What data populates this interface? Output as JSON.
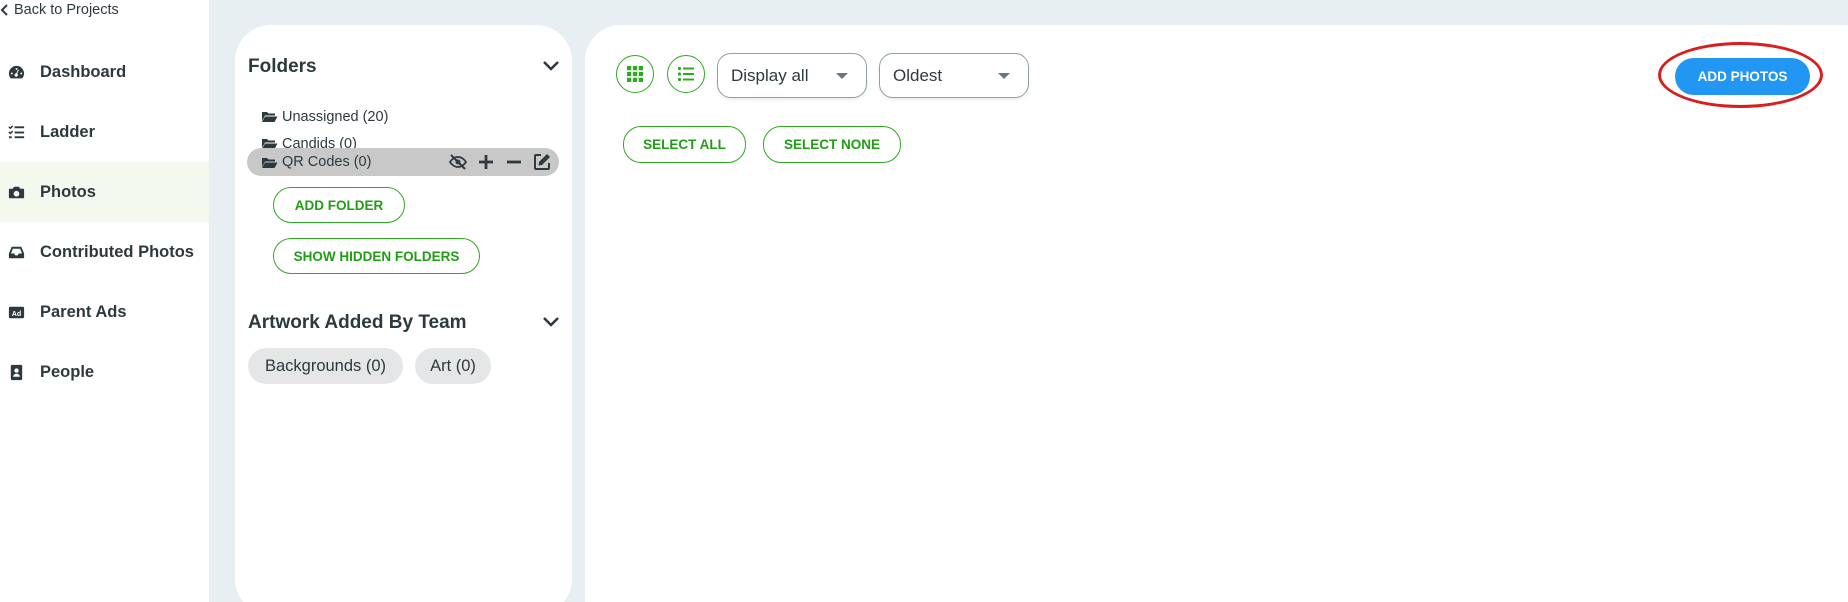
{
  "sidebar": {
    "back_label": "Back to Projects",
    "items": [
      {
        "label": "Dashboard",
        "icon": "dashboard-gauge-icon"
      },
      {
        "label": "Ladder",
        "icon": "checklist-icon"
      },
      {
        "label": "Photos",
        "icon": "camera-icon",
        "active": true
      },
      {
        "label": "Contributed Photos",
        "icon": "inbox-tray-icon"
      },
      {
        "label": "Parent Ads",
        "icon": "ad-badge-icon"
      },
      {
        "label": "People",
        "icon": "contact-card-icon"
      }
    ]
  },
  "folders": {
    "heading": "Folders",
    "items": [
      {
        "label": "Unassigned (20)"
      },
      {
        "label": "Candids (0)"
      },
      {
        "label": "QR Codes (0)",
        "selected": true
      }
    ],
    "add_folder_label": "ADD FOLDER",
    "show_hidden_label": "SHOW HIDDEN FOLDERS"
  },
  "artwork": {
    "heading": "Artwork Added By Team",
    "items": [
      {
        "label": "Backgrounds (0)"
      },
      {
        "label": "Art (0)"
      }
    ]
  },
  "toolbar": {
    "display_filter": "Display all",
    "sort_order": "Oldest",
    "select_all_label": "SELECT ALL",
    "select_none_label": "SELECT NONE",
    "add_photos_label": "ADD PHOTOS"
  },
  "colors": {
    "accent_green": "#2eaa22",
    "primary_blue": "#2196f3",
    "highlight_red": "#d91e1e",
    "background": "#e8eff2"
  }
}
